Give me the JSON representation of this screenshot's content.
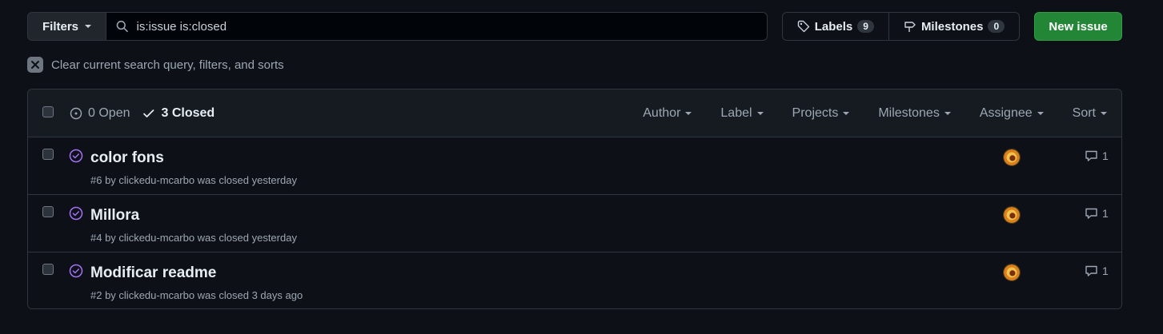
{
  "toolbar": {
    "filters_label": "Filters",
    "search_value": "is:issue is:closed",
    "labels_label": "Labels",
    "labels_count": "9",
    "milestones_label": "Milestones",
    "milestones_count": "0",
    "new_issue_label": "New issue"
  },
  "clear_text": "Clear current search query, filters, and sorts",
  "header": {
    "open_label": "0 Open",
    "closed_label": "3 Closed",
    "menus": [
      "Author",
      "Label",
      "Projects",
      "Milestones",
      "Assignee",
      "Sort"
    ]
  },
  "issues": [
    {
      "title": "color fons",
      "meta": "#6 by clickedu-mcarbo was closed yesterday",
      "comments": "1"
    },
    {
      "title": "Millora",
      "meta": "#4 by clickedu-mcarbo was closed yesterday",
      "comments": "1"
    },
    {
      "title": "Modificar readme",
      "meta": "#2 by clickedu-mcarbo was closed 3 days ago",
      "comments": "1"
    }
  ],
  "colors": {
    "background": "#0d1117",
    "accent_green": "#238636",
    "closed_purple": "#a371f7",
    "border": "#30363d"
  }
}
